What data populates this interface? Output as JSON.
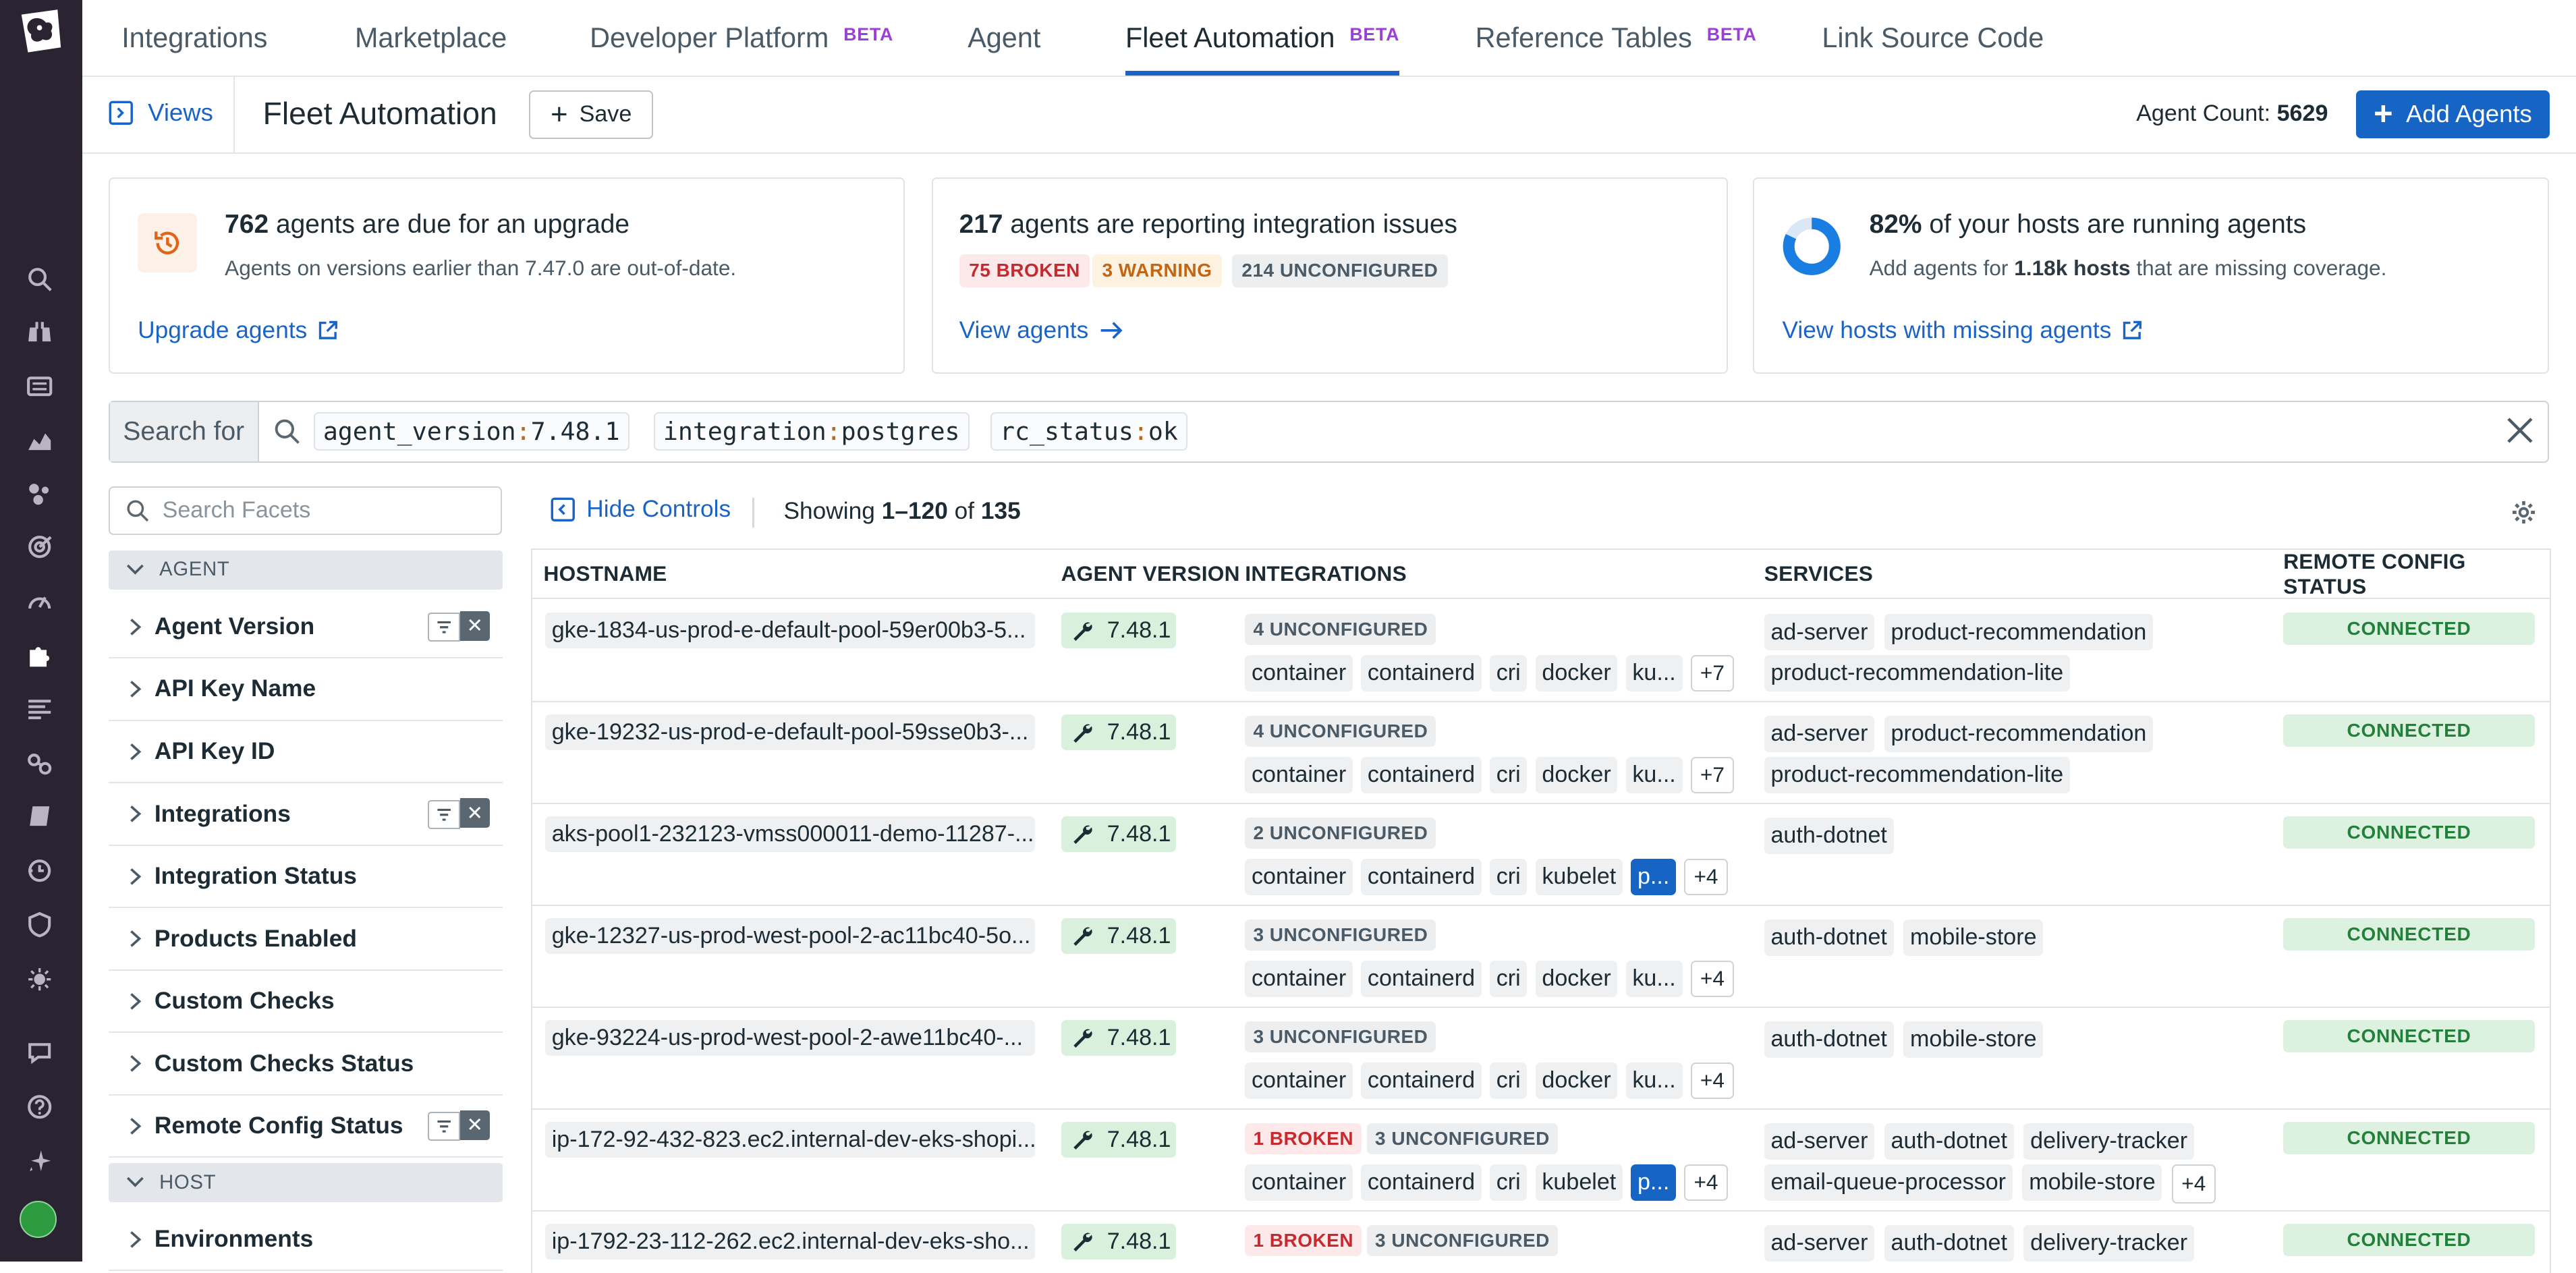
{
  "top_tabs": [
    {
      "label": "Integrations",
      "beta": ""
    },
    {
      "label": "Marketplace",
      "beta": ""
    },
    {
      "label": "Developer Platform",
      "beta": "BETA"
    },
    {
      "label": "Agent",
      "beta": ""
    },
    {
      "label": "Fleet Automation",
      "beta": "BETA"
    },
    {
      "label": "Reference Tables",
      "beta": "BETA"
    },
    {
      "label": "Link Source Code",
      "beta": ""
    }
  ],
  "header": {
    "views_label": "Views",
    "page_title": "Fleet Automation",
    "save_label": "Save",
    "agent_count_label": "Agent Count:",
    "agent_count_value": "5629",
    "add_agents_label": "Add Agents"
  },
  "cards": {
    "upgrade": {
      "count": "762",
      "title_rest": "agents are due for an upgrade",
      "subtitle": "Agents on versions earlier than 7.47.0 are out-of-date.",
      "link": "Upgrade agents"
    },
    "issues": {
      "count": "217",
      "title_rest": "agents are reporting integration issues",
      "badges": [
        "75 BROKEN",
        "3 WARNING",
        "214 UNCONFIGURED"
      ],
      "link": "View agents"
    },
    "coverage": {
      "percent": "82%",
      "title_rest": "of your hosts are running agents",
      "sub_pre": "Add agents for",
      "sub_bold": "1.18k hosts",
      "sub_post": "that are missing coverage.",
      "link": "View hosts with missing agents",
      "coverage_fraction": 0.82
    }
  },
  "search": {
    "label": "Search for",
    "chips": [
      {
        "key": "agent_version",
        "value": "7.48.1"
      },
      {
        "key": "integration",
        "value": "postgres"
      },
      {
        "key": "rc_status",
        "value": "ok"
      }
    ]
  },
  "facets": {
    "search_placeholder": "Search Facets",
    "group_agent": "AGENT",
    "group_host": "HOST",
    "agent_items": [
      "Agent Version",
      "API Key Name",
      "API Key ID",
      "Integrations",
      "Integration Status",
      "Products Enabled",
      "Custom Checks",
      "Custom Checks Status",
      "Remote Config Status"
    ],
    "host_items": [
      "Environments"
    ]
  },
  "controls": {
    "hide_controls": "Hide Controls",
    "showing_pre": "Showing",
    "showing_range": "1–120",
    "showing_of": "of",
    "showing_total": "135"
  },
  "table": {
    "columns": [
      "HOSTNAME",
      "AGENT VERSION",
      "INTEGRATIONS",
      "SERVICES",
      "REMOTE CONFIG STATUS"
    ],
    "rows": [
      {
        "host": "gke-1834-us-prod-e-default-pool-59er00b3-5...",
        "version": "7.48.1",
        "status": [
          "4 UNCONFIGURED"
        ],
        "integrations": [
          "container",
          "containerd",
          "cri",
          "docker",
          "ku...",
          "+7"
        ],
        "services_line1": [
          "ad-server",
          "product-recommendation"
        ],
        "services_line2": [
          "product-recommendation-lite"
        ],
        "rc": "CONNECTED"
      },
      {
        "host": "gke-19232-us-prod-e-default-pool-59sse0b3-...",
        "version": "7.48.1",
        "status": [
          "4 UNCONFIGURED"
        ],
        "integrations": [
          "container",
          "containerd",
          "cri",
          "docker",
          "ku...",
          "+7"
        ],
        "services_line1": [
          "ad-server",
          "product-recommendation"
        ],
        "services_line2": [
          "product-recommendation-lite"
        ],
        "rc": "CONNECTED"
      },
      {
        "host": "aks-pool1-232123-vmss000011-demo-11287-...",
        "version": "7.48.1",
        "status": [
          "2 UNCONFIGURED"
        ],
        "integrations": [
          "container",
          "containerd",
          "cri",
          "kubelet",
          "p...",
          "+4"
        ],
        "services_line1": [
          "auth-dotnet"
        ],
        "services_line2": [],
        "rc": "CONNECTED"
      },
      {
        "host": "gke-12327-us-prod-west-pool-2-ac11bc40-5o...",
        "version": "7.48.1",
        "status": [
          "3 UNCONFIGURED"
        ],
        "integrations": [
          "container",
          "containerd",
          "cri",
          "docker",
          "ku...",
          "+4"
        ],
        "services_line1": [
          "auth-dotnet",
          "mobile-store"
        ],
        "services_line2": [],
        "rc": "CONNECTED"
      },
      {
        "host": "gke-93224-us-prod-west-pool-2-awe11bc40-...",
        "version": "7.48.1",
        "status": [
          "3 UNCONFIGURED"
        ],
        "integrations": [
          "container",
          "containerd",
          "cri",
          "docker",
          "ku...",
          "+4"
        ],
        "services_line1": [
          "auth-dotnet",
          "mobile-store"
        ],
        "services_line2": [],
        "rc": "CONNECTED"
      },
      {
        "host": "ip-172-92-432-823.ec2.internal-dev-eks-shopi...",
        "version": "7.48.1",
        "status": [
          "1 BROKEN",
          "3 UNCONFIGURED"
        ],
        "integrations": [
          "container",
          "containerd",
          "cri",
          "kubelet",
          "p...",
          "+4"
        ],
        "services_line1": [
          "ad-server",
          "auth-dotnet",
          "delivery-tracker"
        ],
        "services_line2": [
          "email-queue-processor",
          "mobile-store",
          "+4"
        ],
        "rc": "CONNECTED"
      },
      {
        "host": "ip-1792-23-112-262.ec2.internal-dev-eks-sho...",
        "version": "7.48.1",
        "status": [
          "1 BROKEN",
          "3 UNCONFIGURED"
        ],
        "integrations": [],
        "services_line1": [
          "ad-server",
          "auth-dotnet",
          "delivery-tracker"
        ],
        "services_line2": [],
        "rc": "CONNECTED"
      }
    ]
  },
  "colors": {
    "accent": "#1664c4",
    "nav_bg": "#2a2331",
    "beta": "#9b3fd8",
    "broken": "#c62a2f",
    "warning": "#c46514",
    "connected": "#23803a"
  },
  "icons": [
    "datadog-logo-icon",
    "search-icon",
    "binoculars-icon",
    "list-icon",
    "chart-icon",
    "bubbles-icon",
    "target-icon",
    "gauge-icon",
    "puzzle-icon",
    "logs-icon",
    "link-icon",
    "book-icon",
    "cog-clock-icon",
    "shield-icon",
    "bug-icon",
    "chat-icon",
    "help-icon",
    "sparkle-icon",
    "avatar"
  ]
}
